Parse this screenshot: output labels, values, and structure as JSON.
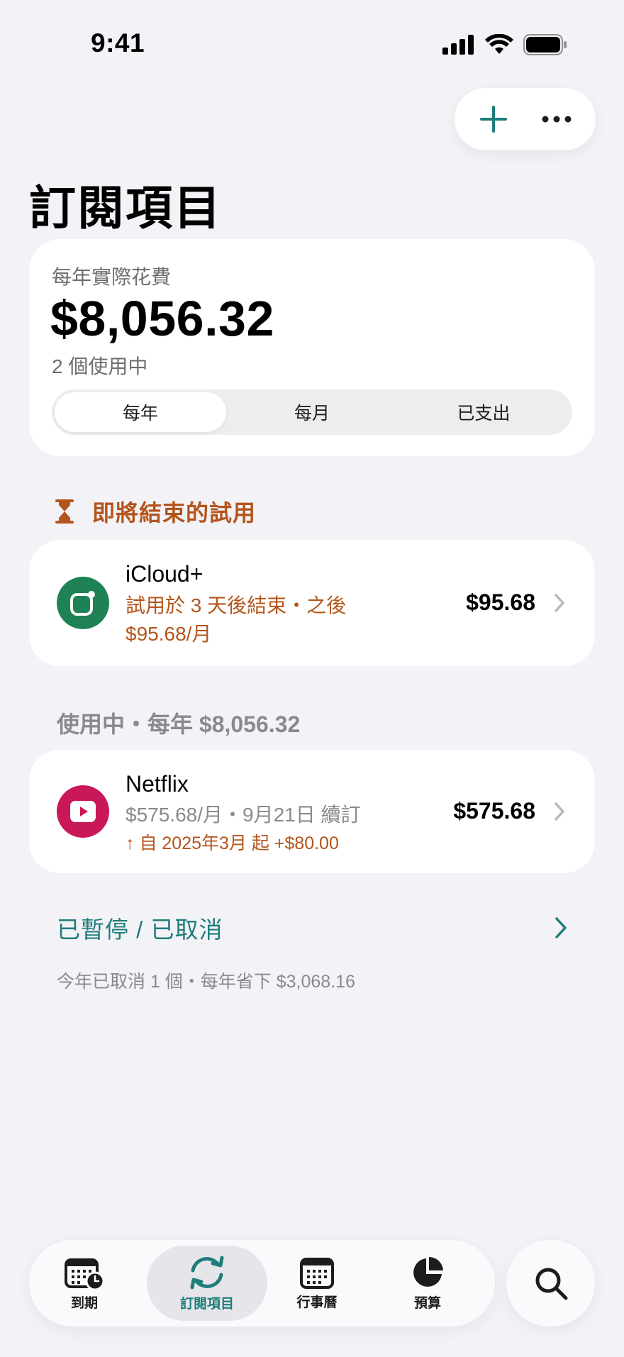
{
  "status_bar": {
    "time": "9:41"
  },
  "page_title": "訂閱項目",
  "summary": {
    "label": "每年實際花費",
    "amount": "$8,056.32",
    "count": "2 個使用中",
    "segments": [
      "每年",
      "每月",
      "已支出"
    ],
    "selected_segment": "每年"
  },
  "trial_section": {
    "title": "即將結束的試用",
    "item": {
      "name": "iCloud+",
      "subtitle_line1": "試用於 3 天後結束・之後",
      "subtitle_line2": "$95.68/月",
      "price": "$95.68",
      "icon": "icloud-icon",
      "icon_color": "#1f8156"
    }
  },
  "active_section": {
    "title": "使用中・每年 $8,056.32",
    "item": {
      "name": "Netflix",
      "subtitle": "$575.68/月・9月21日 續訂",
      "change": "↑ 自 2025年3月 起 +$80.00",
      "price": "$575.68",
      "icon": "play-icon",
      "icon_color": "#c9185a"
    }
  },
  "paused": {
    "label": "已暫停 / 已取消",
    "note": "今年已取消 1 個・每年省下 $3,068.16"
  },
  "tabbar": {
    "tabs": [
      {
        "label": "到期",
        "icon": "calendar-clock-icon"
      },
      {
        "label": "訂閱項目",
        "icon": "refresh-icon"
      },
      {
        "label": "行事曆",
        "icon": "calendar-icon"
      },
      {
        "label": "預算",
        "icon": "pie-chart-icon"
      }
    ],
    "active": "訂閱項目"
  },
  "colors": {
    "accent": "#1e7d7b",
    "warning": "#b4541b",
    "background": "#f2f2f7"
  }
}
